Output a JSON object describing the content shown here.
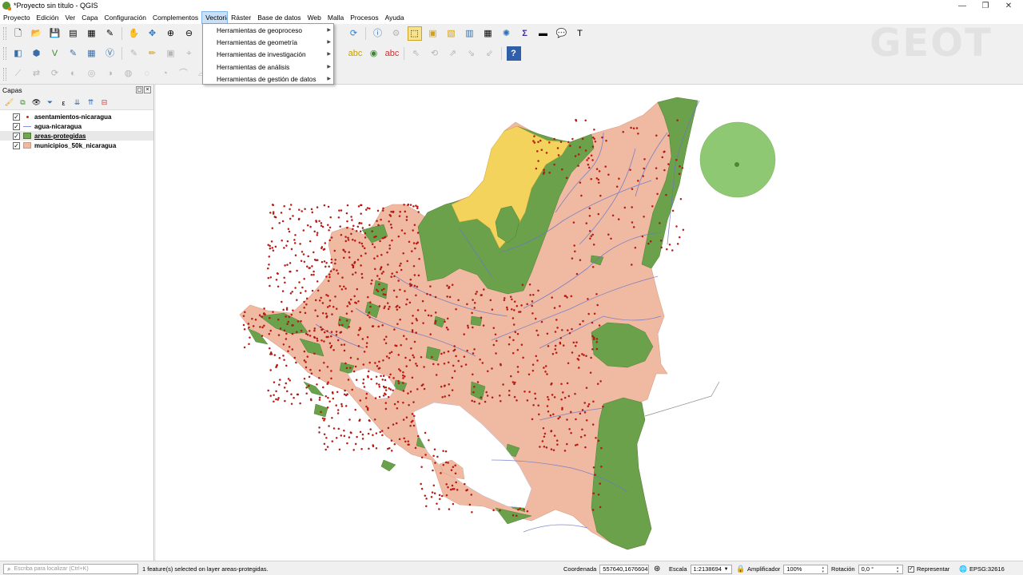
{
  "window": {
    "title": "*Proyecto sin título - QGIS",
    "minimize_glyph": "—",
    "maximize_glyph": "❐",
    "close_glyph": "✕"
  },
  "menu": [
    "Proyecto",
    "Edición",
    "Ver",
    "Capa",
    "Configuración",
    "Complementos",
    "Vectorial",
    "Ráster",
    "Base de datos",
    "Web",
    "Malla",
    "Procesos",
    "Ayuda"
  ],
  "active_menu": "Vectorial",
  "vector_menu_items": [
    "Herramientas de geoproceso",
    "Herramientas de geometría",
    "Herramientas de investigación",
    "Herramientas de análisis",
    "Herramientas de gestión de datos"
  ],
  "watermark_logo": "GEOT",
  "layers_panel": {
    "title": "Capas",
    "layers": [
      {
        "name": "asentamientos-nicaragua",
        "checked": true,
        "symbol": "point",
        "color": "#e31a1c"
      },
      {
        "name": "agua-nicaragua",
        "checked": true,
        "symbol": "line",
        "color": "#8a8fd6"
      },
      {
        "name": "areas-protegidas",
        "checked": true,
        "symbol": "fill",
        "color": "#6fa84e",
        "selected": true
      },
      {
        "name": "municipios_50k_nicaragua",
        "checked": true,
        "symbol": "fill",
        "color": "#f0b8a0"
      }
    ]
  },
  "colors": {
    "municipios": "#f0b9a1",
    "protected": "#6aa14a",
    "protected_light": "#8fc873",
    "yellow_area": "#f3d35c",
    "water": "#6b76c9",
    "settlement": "#d0150f"
  },
  "status": {
    "locator_placeholder": "Escriba para localizar (Ctrl+K)",
    "message": "1 feature(s) selected on layer areas-protegidas.",
    "coord_label": "Coordenada",
    "coord_value": "557640,1676604",
    "scale_label": "Escala",
    "scale_value": "1:2138694",
    "magnifier_label": "Amplificador",
    "magnifier_value": "100%",
    "rotation_label": "Rotación",
    "rotation_value": "0,0 °",
    "render_label": "Representar",
    "crs": "EPSG:32616"
  }
}
